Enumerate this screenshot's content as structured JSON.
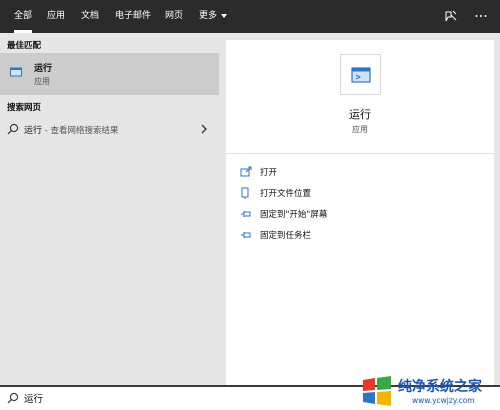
{
  "tabs": [
    {
      "label": "全部",
      "active": true
    },
    {
      "label": "应用",
      "active": false
    },
    {
      "label": "文档",
      "active": false
    },
    {
      "label": "电子邮件",
      "active": false
    },
    {
      "label": "网页",
      "active": false
    },
    {
      "label": "更多",
      "active": false
    }
  ],
  "left": {
    "best_match_header": "最佳匹配",
    "best_match": {
      "title": "运行",
      "subtitle": "应用",
      "icon": "run-app-icon"
    },
    "web_header": "搜索网页",
    "web_result": {
      "query": "运行",
      "hint": " - 查看网络搜索结果"
    }
  },
  "right": {
    "app_name": "运行",
    "app_type": "应用",
    "actions": [
      {
        "label": "打开",
        "icon": "open-icon"
      },
      {
        "label": "打开文件位置",
        "icon": "file-location-icon"
      },
      {
        "label": "固定到\"开始\"屏幕",
        "icon": "pin-start-icon"
      },
      {
        "label": "固定到任务栏",
        "icon": "pin-taskbar-icon"
      }
    ]
  },
  "search": {
    "value": "运行"
  },
  "watermark": {
    "title": "纯净系统之家",
    "url": "www.ycwjzy.com"
  },
  "colors": {
    "topbar": "#2b2b2b",
    "accent": "#1a56b0",
    "selected": "#cccccc",
    "icon_blue": "#2e75c8"
  }
}
